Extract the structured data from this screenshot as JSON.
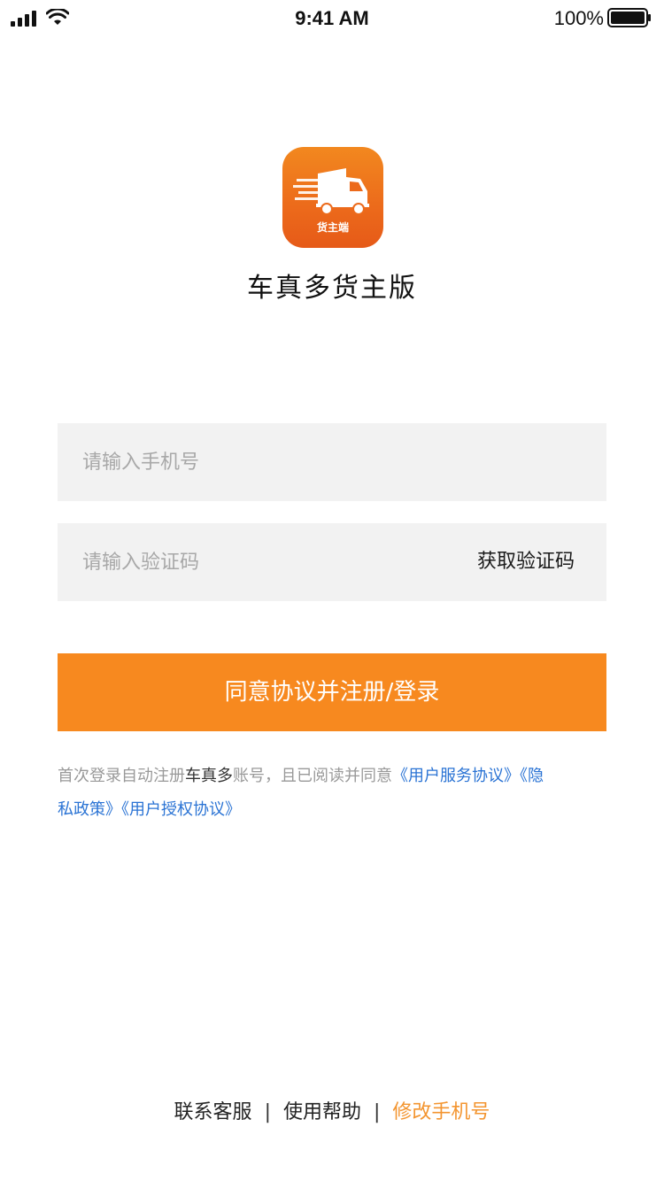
{
  "status_bar": {
    "time": "9:41 AM",
    "battery_percent": "100%",
    "icons": [
      "signal-icon",
      "wifi-icon",
      "battery-icon"
    ]
  },
  "app": {
    "icon_label": "货主端",
    "icon": "truck-icon",
    "name": "车真多货主版"
  },
  "form": {
    "phone_placeholder": "请输入手机号",
    "code_placeholder": "请输入验证码",
    "get_code_label": "获取验证码",
    "submit_label": "同意协议并注册/登录"
  },
  "agreement": {
    "prefix": "首次登录自动注册",
    "brand": "车真多",
    "middle": "账号，且已阅读并同意",
    "link_service": "《用户服务协议》",
    "link_privacy": "《隐私政策》",
    "link_authorization": "《用户授权协议》"
  },
  "footer": {
    "contact": "联系客服",
    "separator": "|",
    "help": "使用帮助",
    "change_phone": "修改手机号"
  },
  "colors": {
    "accent": "#f7891f",
    "link": "#2a73d4",
    "field_bg": "#f2f2f2"
  }
}
